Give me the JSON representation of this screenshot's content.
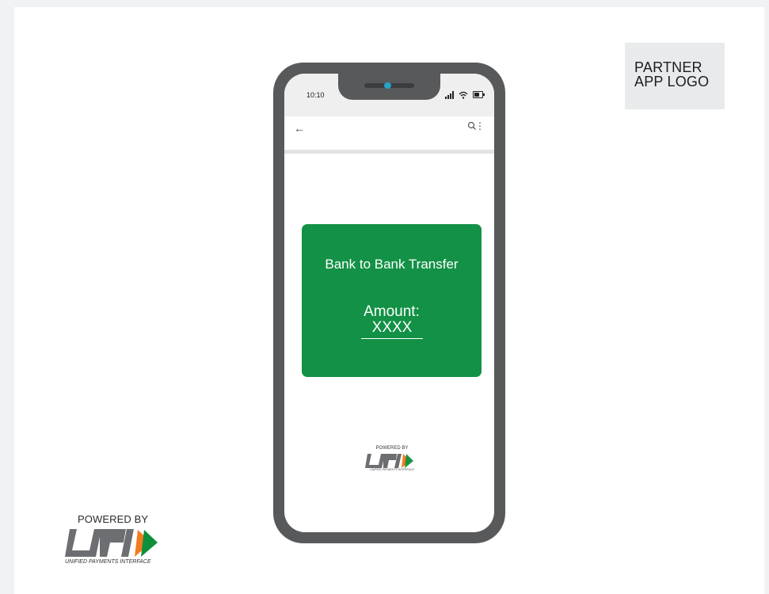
{
  "partner_logo": {
    "line1": "PARTNER",
    "line2": "APP LOGO"
  },
  "phone": {
    "status_bar": {
      "time": "10:10",
      "icons": [
        "signal-icon",
        "wifi-icon",
        "battery-icon"
      ]
    },
    "app_bar": {
      "back_icon": "back-arrow-icon",
      "search_icon": "search-icon",
      "more_icon": "more-vertical-icon"
    },
    "card": {
      "title": "Bank to Bank Transfer",
      "amount_label": "Amount:",
      "amount_value": "XXXX",
      "color": "#139146"
    },
    "branding": {
      "powered_by": "POWERED BY",
      "logo_text": "UPI",
      "subtitle": "UNIFIED PAYMENTS INTERFACE"
    }
  },
  "branding": {
    "powered_by": "POWERED BY",
    "logo_text": "UPI",
    "subtitle": "UNIFIED PAYMENTS INTERFACE",
    "accent_orange": "#f47b20",
    "accent_green": "#0f8f3c",
    "logo_gray": "#6d6e71"
  }
}
